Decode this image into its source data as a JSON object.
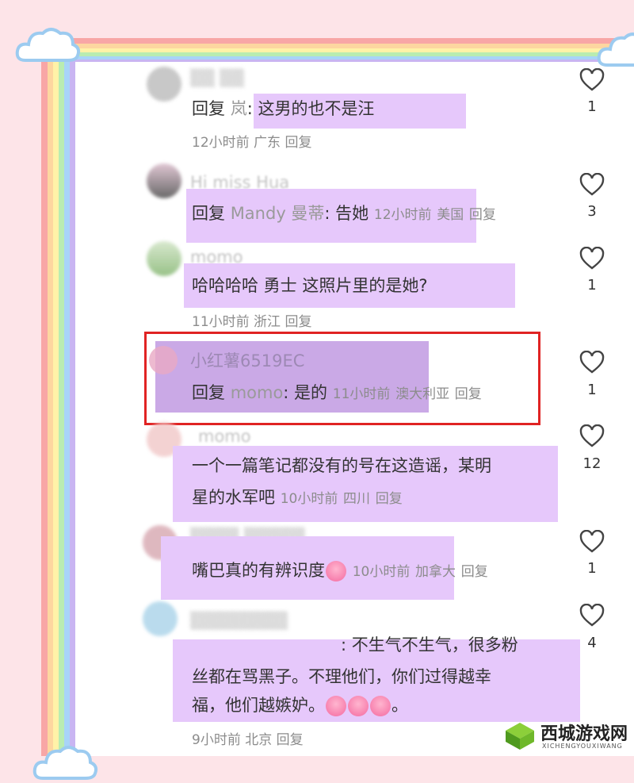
{
  "colors": {
    "highlight": "#e6c8fb",
    "red_box": "#e02323",
    "rainbow": [
      "#f8a6a6",
      "#fdd6a0",
      "#fff2a8",
      "#b9ecb1",
      "#a8d4f8",
      "#c9b5f2"
    ]
  },
  "comments": [
    {
      "username": "",
      "reply_prefix": "回复",
      "reply_to": "岚",
      "text": ": 这男的也不是汪",
      "time": "12小时前",
      "location": "广东",
      "reply_label": "回复",
      "likes": "1"
    },
    {
      "username": "Hi miss Hua",
      "reply_prefix": "回复",
      "reply_to": "Mandy 曼蒂",
      "text": ": 告她",
      "time": "12小时前",
      "location": "美国",
      "reply_label": "回复",
      "likes": "3"
    },
    {
      "username": "momo",
      "text": "哈哈哈哈 勇士 这照片里的是她?",
      "time": "11小时前",
      "location": "浙江",
      "reply_label": "回复",
      "likes": "1"
    },
    {
      "username": "小红薯6519EC",
      "reply_prefix": "回复",
      "reply_to": "momo",
      "text": ": 是的",
      "time": "11小时前",
      "location": "澳大利亚",
      "reply_label": "回复",
      "likes": "1"
    },
    {
      "username": "momo",
      "text_line1": "一个一篇笔记都没有的号在这造谣，某明",
      "text_line2": "星的水军吧",
      "time": "10小时前",
      "location": "四川",
      "reply_label": "回复",
      "likes": "12"
    },
    {
      "username": "",
      "text": "嘴巴真的有辨识度",
      "time": "10小时前",
      "location": "加拿大",
      "reply_label": "回复",
      "likes": "1"
    },
    {
      "username": "",
      "text_line1": ": 不生气不生气，很多粉",
      "text_line2": "丝都在骂黑子。不理他们，你们过得越幸",
      "text_line3": "福，他们越嫉妒。",
      "text_line3_end": "。",
      "time": "9小时前",
      "location": "北京",
      "reply_label": "回复",
      "likes": "4"
    }
  ],
  "watermark": {
    "title": "西城游戏网",
    "subtitle": "XICHENGYOUXIWANG"
  },
  "icons": {
    "like": "heart-outline-icon",
    "emoji": "crying-face-emoji"
  }
}
